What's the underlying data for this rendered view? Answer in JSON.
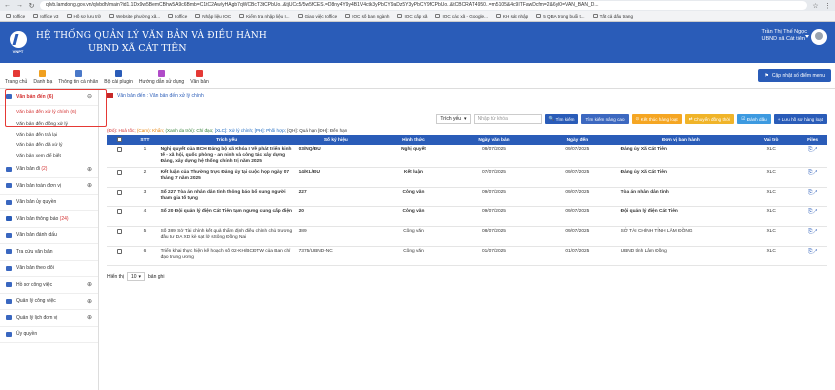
{
  "browser": {
    "url": "qlvb.lamdong.gov.vn/qlvbdh/main?id1.1Dx9w5BemCBhw5A9c6Bmb=C1tC2Aw/yHAgb7qWCBcT3tCPbUo..&tjUCc5/5w5fCES.=D8ny4Y9y4B1V4ctk3yPbCY9aDz5Y3yPbCY9fCPbUo..&tCBCRAT4950..=m5105&4c9ITFawDcfm=2&6yl0=VAN_BAN_D...",
    "bookmarks": [
      "Ioffice",
      "Ioffice v3",
      "Hồ sơ lưu trữ",
      "Website phường xã...",
      "Ioffice",
      "Nhập liệu IOC",
      "Kiểm tra nhập liệu I...",
      "Giao việc Ioffice",
      "IOC số ban ngành",
      "IOC cấp xã",
      "IOC các xã - Google...",
      "KH sát nhập",
      "5 QBA trong buổi t...",
      "Tất cả dấu trang"
    ]
  },
  "header": {
    "logo_text": "VNPT",
    "title_line1": "HỆ THỐNG QUẢN LÝ VĂN BẢN VÀ ĐIỀU HÀNH",
    "title_line2": "UBND XÃ CÁT TIÊN",
    "user_name": "Trần Thị Thế Ngọc",
    "user_unit": "UBND xã Cát tiên"
  },
  "toolbar": {
    "items": [
      "Trang chủ",
      "Danh bạ",
      "Thông tin cá nhân",
      "Bộ cài plugin",
      "Hướng dẫn sử dụng",
      "Văn bản"
    ],
    "sync_label": "Cập nhật số điểm menu"
  },
  "sidebar": {
    "head_label": "Văn bản đến",
    "head_count": "(6)",
    "sub_active": "Văn bản đến xử lý chính (6)",
    "subs": [
      "Văn bản đến đồng xử lý",
      "Văn bản đến trả lại",
      "Văn bản đến đã xử lý",
      "Văn bản xem để biết"
    ],
    "items": [
      {
        "label": "Văn bản đi",
        "count": "(2)"
      },
      {
        "label": "Văn bản toàn đơn vị",
        "count": ""
      },
      {
        "label": "Văn bản ủy quyền",
        "count": ""
      },
      {
        "label": "Văn bản thông báo",
        "count": "(24)"
      },
      {
        "label": "Văn bản đánh dấu",
        "count": ""
      },
      {
        "label": "Tra cứu văn bản",
        "count": ""
      },
      {
        "label": "Văn bản theo dõi",
        "count": ""
      },
      {
        "label": "Hồ sơ công việc",
        "count": ""
      },
      {
        "label": "Quản lý công việc",
        "count": ""
      },
      {
        "label": "Quản lý lịch đơn vị",
        "count": ""
      },
      {
        "label": "Ủy quyền",
        "count": ""
      }
    ]
  },
  "content": {
    "breadcrumb": "Văn bản đến : Văn bản đến xử lý chính",
    "filter_label": "Trích yếu",
    "search_placeholder": "Nhập từ khóa",
    "buttons": {
      "search": "Tìm kiếm",
      "adv_search": "Tìm kiếm nâng cao",
      "finish": "Kết thúc hàng loạt",
      "move": "Chuyển đồng thời",
      "mark": "Đánh dấu",
      "save": "Lưu hồ sơ hàng loạt"
    },
    "legend": {
      "red": "(Đỏ): Hoả tốc;",
      "orange": "(Cam): Khẩn;",
      "green": "(Xanh da trời): Chỉ đạo;",
      "blue": "[XLC]: Xử lý chính;",
      "blue2": "[PH]: Phối hợp;",
      "dark": "[QH]: Quá hạn",
      "dark2": "[ĐH]: Đến hạn"
    },
    "columns": [
      "STT",
      "Trích yếu",
      "Số ký hiệu",
      "Hình thức",
      "Ngày văn bản",
      "Ngày đến",
      "Đơn vị ban hành",
      "Vai trò",
      "Files"
    ],
    "rows": [
      {
        "stt": "1",
        "summary": "Nghị quyết của BCH Đảng bộ xã Khóa I Về phát triển kinh tế - xã hội, quốc phòng - an ninh và công tác xây dựng Đảng, xây dựng hệ thống chính trị năm 2025",
        "code": "03/NQ/ĐU",
        "type": "Nghị quyết",
        "date": "08/07/2025",
        "arrived": "09/07/2025",
        "unit": "Đảng ủy Xã Cát Tiên",
        "role": "XLC",
        "bold": true
      },
      {
        "stt": "2",
        "summary": "Kết luận của Thường trực Đảng ủy tại cuộc họp ngày 07 tháng 7 năm 2025",
        "code": "14/KL/ĐU",
        "type": "Kết luận",
        "date": "07/07/2025",
        "arrived": "09/07/2025",
        "unit": "Đảng ủy Xã Cát Tiên",
        "role": "XLC",
        "bold": true
      },
      {
        "stt": "3",
        "summary": "Số 227 Tòa án nhân dân tỉnh thông báo bổ sung người tham gia tố tụng",
        "code": "227",
        "type": "Công văn",
        "date": "09/07/2025",
        "arrived": "09/07/2025",
        "unit": "Tòa án nhân dân tỉnh",
        "role": "XLC",
        "bold": true
      },
      {
        "stt": "4",
        "summary": "Số 20 Đội quản lý điện Cát Tiên tạm ngưng cung cấp điện",
        "code": "20",
        "type": "Công văn",
        "date": "09/07/2025",
        "arrived": "09/07/2025",
        "unit": "Đội quản lý điện Cát Tiên",
        "role": "XLC",
        "bold": true
      },
      {
        "stt": "5",
        "summary": "Số 389 Sở Tài chính kết quả thẩm định điều chỉnh chủ trương đầu tư DA XD kè sạt lở sSông Đồng Nai",
        "code": "389",
        "type": "Công văn",
        "date": "08/07/2025",
        "arrived": "09/07/2025",
        "unit": "SỞ TÀI CHÍNH TỈNH LÂM ĐỒNG",
        "role": "XLC",
        "bold": false
      },
      {
        "stt": "6",
        "summary": "Triển khai thực hiện kế hoạch số 02-KH/BCĐTW của Ban chỉ đạo trung ương",
        "code": "7375/UBND-NC",
        "type": "Công văn",
        "date": "01/07/2025",
        "arrived": "01/07/2025",
        "unit": "UBND tỉnh Lâm Đồng",
        "role": "XLC",
        "bold": false
      }
    ],
    "paging": {
      "show_label": "Hiển thị",
      "page_size": "10",
      "suffix": "bản ghi"
    }
  }
}
